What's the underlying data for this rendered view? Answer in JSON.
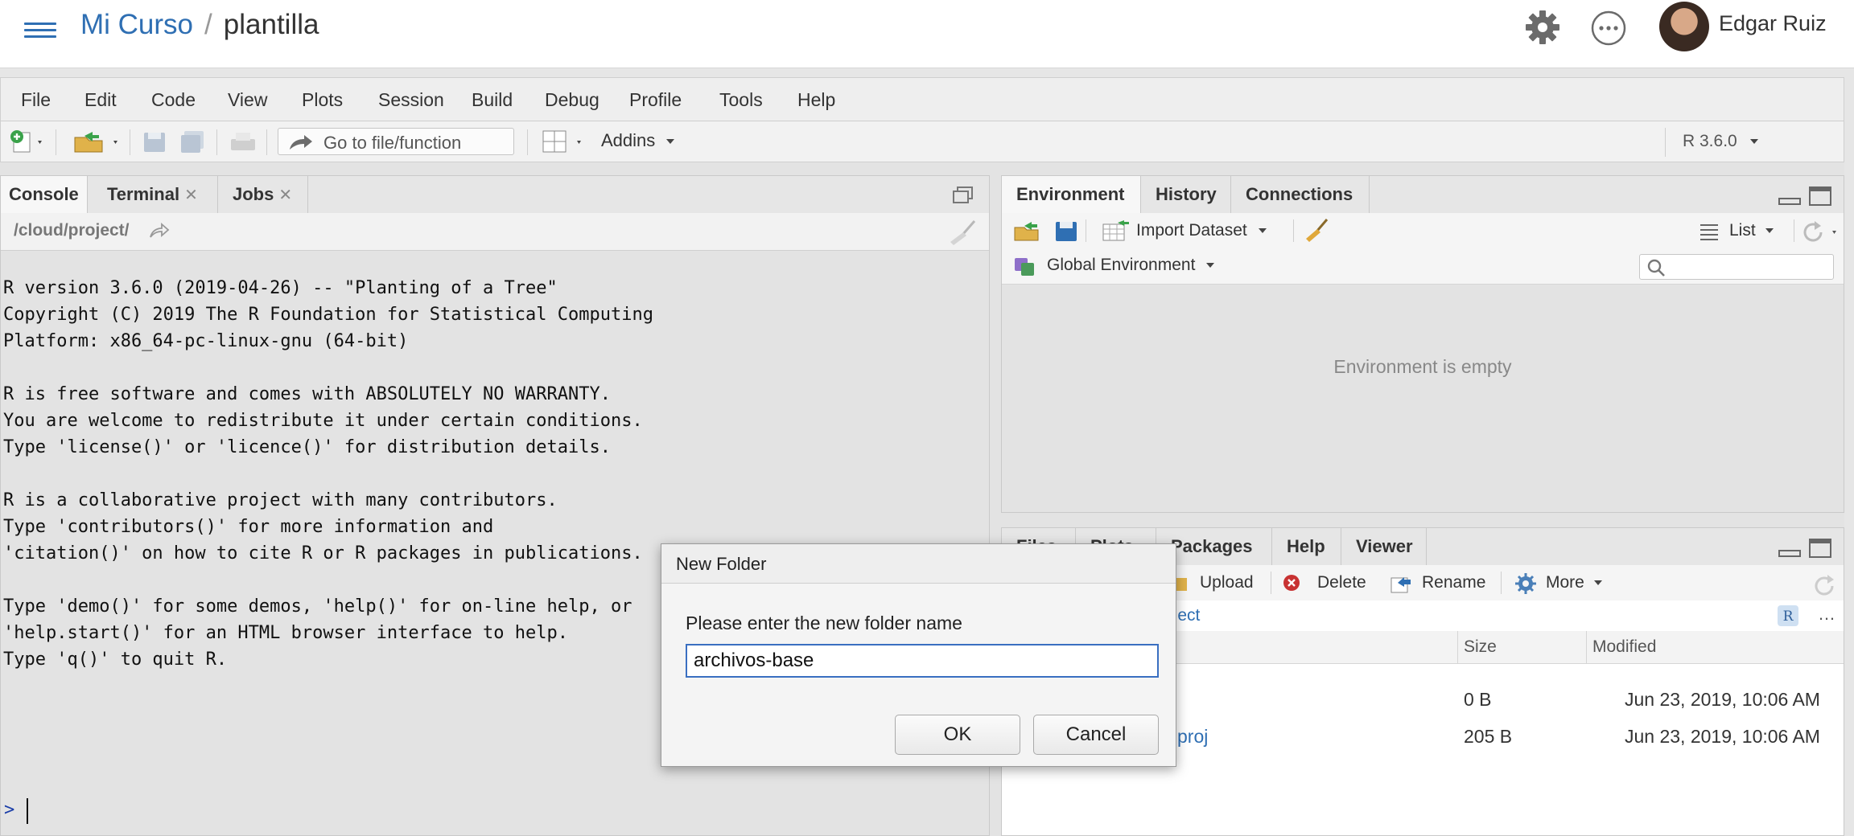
{
  "header": {
    "course": "Mi Curso",
    "separator": "/",
    "project": "plantilla",
    "user": "Edgar Ruiz"
  },
  "menu": [
    "File",
    "Edit",
    "Code",
    "View",
    "Plots",
    "Session",
    "Build",
    "Debug",
    "Profile",
    "Tools",
    "Help"
  ],
  "toolbar": {
    "goto_placeholder": "Go to file/function",
    "addins": "Addins",
    "r_version": "R 3.6.0"
  },
  "console_pane": {
    "tabs": [
      "Console",
      "Terminal",
      "Jobs"
    ],
    "path": "/cloud/project/",
    "prompt": ">",
    "startup_text": "R version 3.6.0 (2019-04-26) -- \"Planting of a Tree\"\nCopyright (C) 2019 The R Foundation for Statistical Computing\nPlatform: x86_64-pc-linux-gnu (64-bit)\n\nR is free software and comes with ABSOLUTELY NO WARRANTY.\nYou are welcome to redistribute it under certain conditions.\nType 'license()' or 'licence()' for distribution details.\n\nR is a collaborative project with many contributors.\nType 'contributors()' for more information and\n'citation()' on how to cite R or R packages in publications.\n\nType 'demo()' for some demos, 'help()' for on-line help, or\n'help.start()' for an HTML browser interface to help.\nType 'q()' to quit R."
  },
  "env_pane": {
    "tabs": [
      "Environment",
      "History",
      "Connections"
    ],
    "import_dataset": "Import Dataset",
    "list_label": "List",
    "global_env": "Global Environment",
    "empty_message": "Environment is empty"
  },
  "files_pane": {
    "tabs": [
      "Files",
      "Plots",
      "Packages",
      "Help",
      "Viewer"
    ],
    "upload": "Upload",
    "delete": "Delete",
    "rename": "Rename",
    "more": "More",
    "path_fragment": "oject",
    "columns": [
      "Size",
      "Modified"
    ],
    "rows": [
      {
        "name": "",
        "size": "0 B",
        "modified": "Jun 23, 2019, 10:06 AM"
      },
      {
        "name": "proj",
        "size": "205 B",
        "modified": "Jun 23, 2019, 10:06 AM"
      }
    ]
  },
  "dialog": {
    "title": "New Folder",
    "label": "Please enter the new folder name",
    "value": "archivos-base",
    "ok": "OK",
    "cancel": "Cancel"
  },
  "colors": {
    "link_blue": "#2f6fb3",
    "dialog_focus": "#3a6fc1",
    "prompt_blue": "#1a3da8"
  }
}
